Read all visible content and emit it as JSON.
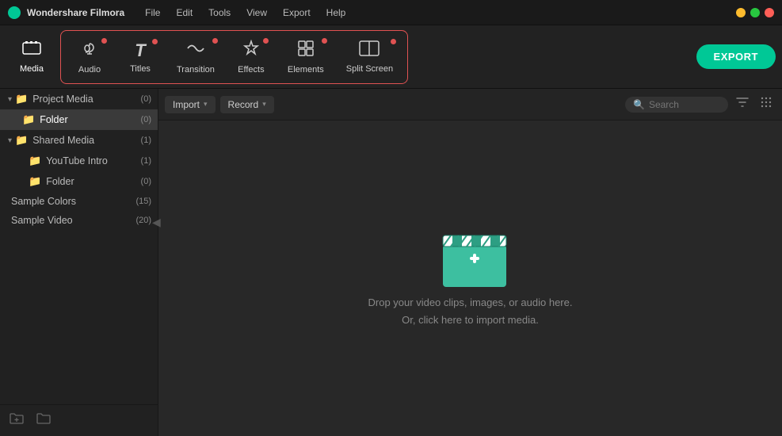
{
  "titlebar": {
    "app_name": "Wondershare Filmora",
    "menu": [
      "File",
      "Edit",
      "Tools",
      "View",
      "Export",
      "Help"
    ]
  },
  "toolbar": {
    "media_label": "Media",
    "audio_label": "Audio",
    "titles_label": "Titles",
    "transition_label": "Transition",
    "effects_label": "Effects",
    "elements_label": "Elements",
    "split_screen_label": "Split Screen",
    "export_label": "EXPORT"
  },
  "content_toolbar": {
    "import_label": "Import",
    "record_label": "Record",
    "search_placeholder": "Search"
  },
  "sidebar": {
    "sections": [
      {
        "label": "Project Media",
        "count": "(0)",
        "indent": 0,
        "expandable": true
      },
      {
        "label": "Folder",
        "count": "(0)",
        "indent": 0,
        "selected": true
      },
      {
        "label": "Shared Media",
        "count": "(1)",
        "indent": 0,
        "expandable": true
      },
      {
        "label": "YouTube Intro",
        "count": "(1)",
        "indent": 1
      },
      {
        "label": "Folder",
        "count": "(0)",
        "indent": 1
      },
      {
        "label": "Sample Colors",
        "count": "(15)",
        "indent": 0
      },
      {
        "label": "Sample Video",
        "count": "(20)",
        "indent": 0
      }
    ]
  },
  "dropzone": {
    "line1": "Drop your video clips, images, or audio here.",
    "line2": "Or, click here to import media."
  },
  "icons": {
    "media": "🎞",
    "audio": "♪",
    "titles": "T",
    "transition": "↔",
    "effects": "✦",
    "elements": "⊞",
    "split_screen": "⊟",
    "folder_open": "📂",
    "folder": "📁",
    "search": "🔍",
    "filter": "▽",
    "grid": "⠿",
    "add_folder": "📁+",
    "new_folder": "📁"
  },
  "colors": {
    "accent": "#00c896",
    "badge": "#e05252",
    "selected_bg": "#3a3a3a"
  }
}
